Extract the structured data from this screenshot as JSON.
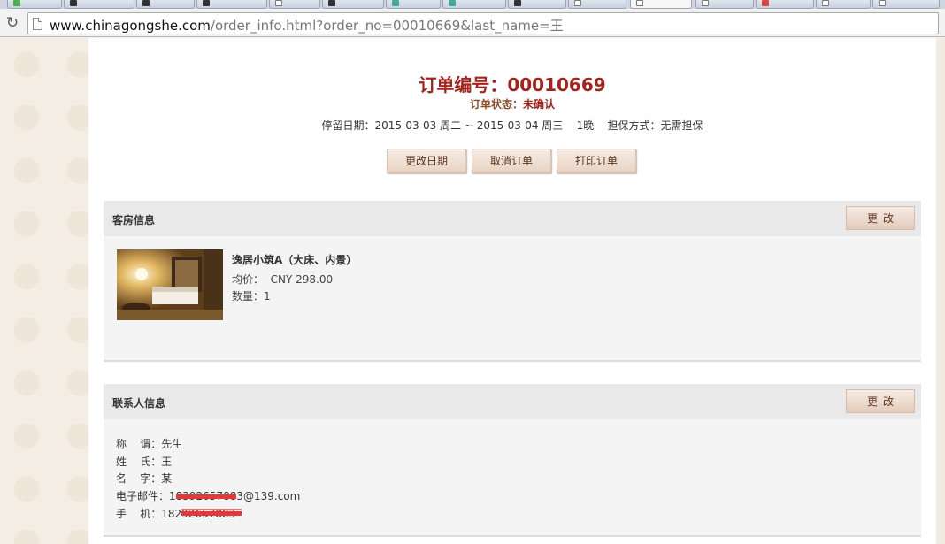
{
  "browser": {
    "url_domain": "www.chinagongshe.com",
    "url_path": "/order_info.html?order_no=00010669&last_name=王"
  },
  "order": {
    "title": "订单编号：00010669",
    "status_label": "订单状态：",
    "status_value": "未确认",
    "stay_info": "停留日期：2015-03-03 周二 ~ 2015-03-04 周三    1晚    担保方式：无需担保"
  },
  "actions": {
    "change_date": "更改日期",
    "cancel_order": "取消订单",
    "print_order": "打印订单"
  },
  "room_section": {
    "title": "客房信息",
    "edit_label": "更改",
    "room_name": "逸居小筑A（大床、内景）",
    "avg_price": "均价：  CNY 298.00",
    "quantity": "数量：1"
  },
  "contact_section": {
    "title": "联系人信息",
    "edit_label": "更改",
    "salutation": "称    谓：先生",
    "surname": "姓    氏：王",
    "given_name": "名    字：某",
    "email": "电子邮件：18392657883@139.com",
    "phone": "手    机：18292657883"
  },
  "colors": {
    "title_red": "#a3241c",
    "button_bg": "#efdfd3",
    "section_bg": "#f4f4f4",
    "redaction": "#e23a3a"
  }
}
